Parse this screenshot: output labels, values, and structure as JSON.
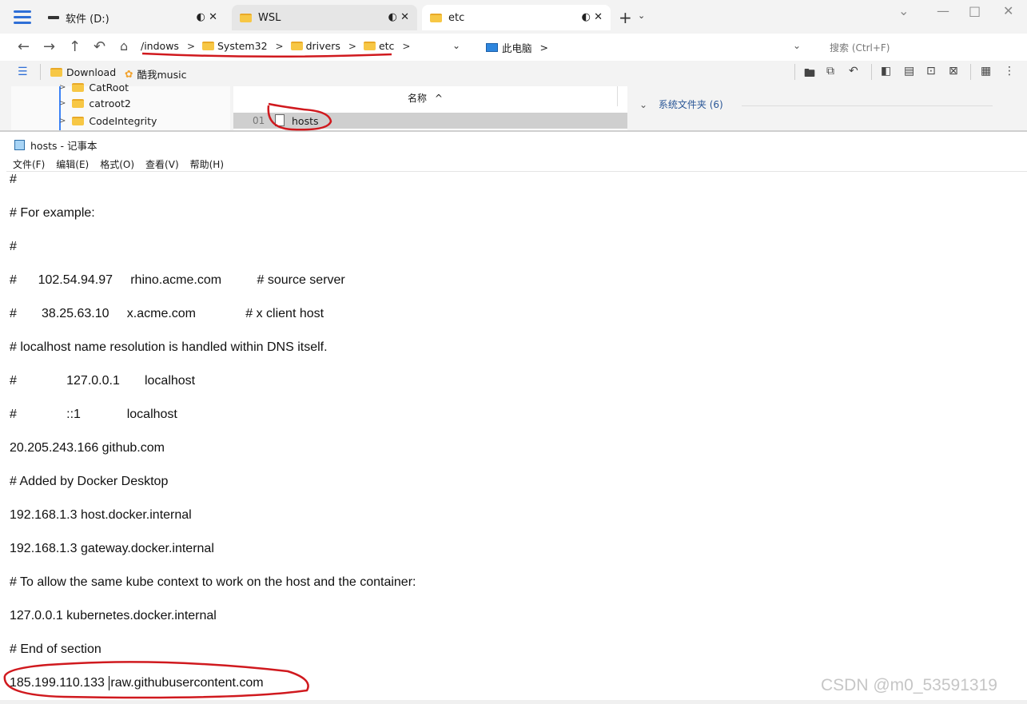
{
  "explorer": {
    "tabs": [
      {
        "label": "软件 (D:)",
        "icon": "drive-icon",
        "ctl": "◐ ✕"
      },
      {
        "label": "WSL",
        "icon": "folder-icon",
        "ctl": "◐ ✕"
      },
      {
        "label": "etc",
        "icon": "folder-icon",
        "ctl": "◐ ✕"
      }
    ],
    "breadcrumbs": [
      "Windows",
      "System32",
      "drivers",
      "etc"
    ],
    "breadcrumb_first_visible": "/indows",
    "this_pc": "此电脑",
    "search_placeholder": "搜索 (Ctrl+F)",
    "bookmarks": [
      "Download",
      "酷我music"
    ],
    "tree_items": [
      "CatRoot",
      "catroot2",
      "CodeIntegrity"
    ],
    "column_header": "名称",
    "sort_indicator": "^",
    "file_row": {
      "index": "01",
      "name": "hosts"
    },
    "right_group": "系统文件夹 (6)",
    "accent_color": "#2f6fd6"
  },
  "notepad": {
    "title": "hosts - 记事本",
    "menu": [
      "文件(F)",
      "编辑(E)",
      "格式(O)",
      "查看(V)",
      "帮助(H)"
    ],
    "lines": [
      "#",
      "# For example:",
      "#",
      "#      102.54.94.97     rhino.acme.com          # source server",
      "#       38.25.63.10     x.acme.com              # x client host",
      "# localhost name resolution is handled within DNS itself.",
      "#              127.0.0.1       localhost",
      "#              ::1             localhost",
      "20.205.243.166 github.com",
      "# Added by Docker Desktop",
      "192.168.1.3 host.docker.internal",
      "192.168.1.3 gateway.docker.internal",
      "# To allow the same kube context to work on the host and the container:",
      "127.0.0.1 kubernetes.docker.internal",
      "# End of section"
    ],
    "last_line_ip": "185.199.110.133",
    "last_line_host": "raw.githubusercontent.com"
  },
  "watermark": "CSDN @m0_53591319",
  "annotation_color": "#d0191e"
}
